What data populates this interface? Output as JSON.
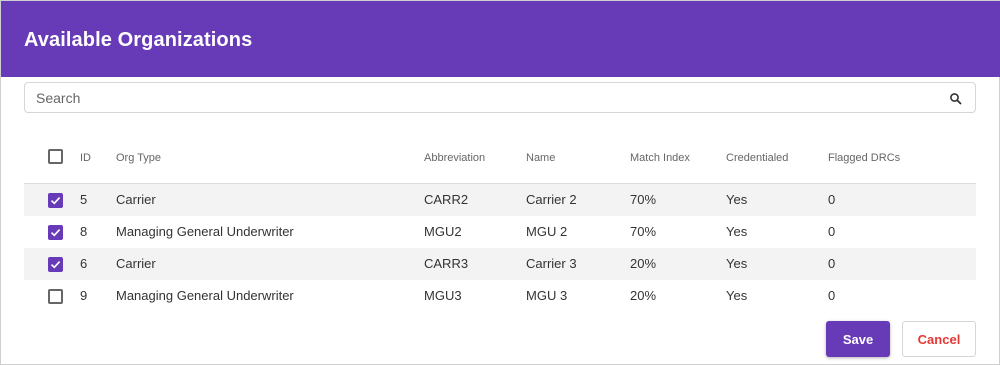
{
  "dialog": {
    "title": "Available Organizations"
  },
  "search": {
    "placeholder": "Search",
    "value": "",
    "icon": "search-icon"
  },
  "table": {
    "columns": {
      "id": "ID",
      "org_type": "Org Type",
      "abbreviation": "Abbreviation",
      "name": "Name",
      "match_index": "Match Index",
      "credentialed": "Credentialed",
      "flagged_drcs": "Flagged DRCs"
    },
    "select_all_checked": false,
    "rows": [
      {
        "checked": true,
        "id": "5",
        "org_type": "Carrier",
        "abbreviation": "CARR2",
        "name": "Carrier 2",
        "match_index": "70%",
        "credentialed": "Yes",
        "flagged_drcs": "0"
      },
      {
        "checked": true,
        "id": "8",
        "org_type": "Managing General Underwriter",
        "abbreviation": "MGU2",
        "name": "MGU 2",
        "match_index": "70%",
        "credentialed": "Yes",
        "flagged_drcs": "0"
      },
      {
        "checked": true,
        "id": "6",
        "org_type": "Carrier",
        "abbreviation": "CARR3",
        "name": "Carrier 3",
        "match_index": "20%",
        "credentialed": "Yes",
        "flagged_drcs": "0"
      },
      {
        "checked": false,
        "id": "9",
        "org_type": "Managing General Underwriter",
        "abbreviation": "MGU3",
        "name": "MGU 3",
        "match_index": "20%",
        "credentialed": "Yes",
        "flagged_drcs": "0"
      }
    ]
  },
  "actions": {
    "save_label": "Save",
    "cancel_label": "Cancel"
  },
  "colors": {
    "accent": "#673ab7",
    "cancel_text": "#e53935"
  }
}
